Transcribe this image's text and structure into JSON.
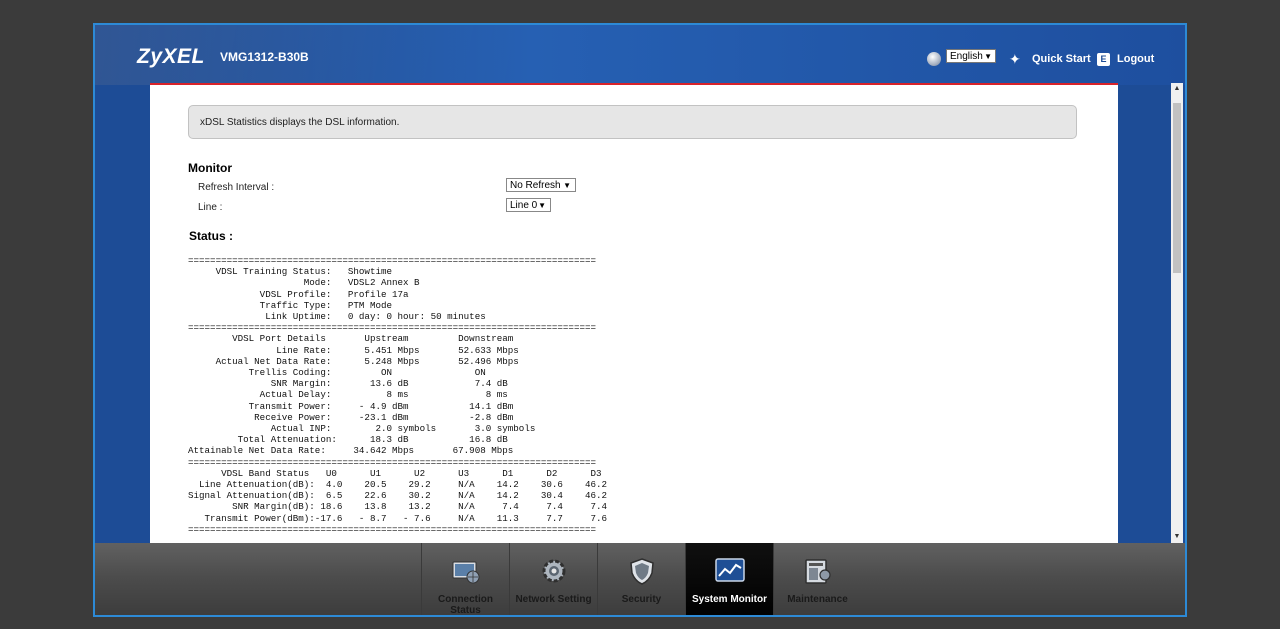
{
  "header": {
    "brand": "ZyXEL",
    "model": "VMG1312-B30B",
    "language": "English",
    "quick_start": "Quick Start",
    "logout": "Logout"
  },
  "info_message": "xDSL Statistics displays the DSL information.",
  "monitor": {
    "title": "Monitor",
    "refresh_label": "Refresh Interval :",
    "refresh_value": "No Refresh",
    "line_label": "Line :",
    "line_value": "Line 0"
  },
  "status": {
    "title": "Status :",
    "text": "==========================================================================\n     VDSL Training Status:   Showtime\n                     Mode:   VDSL2 Annex B\n             VDSL Profile:   Profile 17a\n             Traffic Type:   PTM Mode\n              Link Uptime:   0 day: 0 hour: 50 minutes\n==========================================================================\n        VDSL Port Details       Upstream         Downstream\n                Line Rate:      5.451 Mbps       52.633 Mbps\n     Actual Net Data Rate:      5.248 Mbps       52.496 Mbps\n           Trellis Coding:         ON               ON\n               SNR Margin:       13.6 dB            7.4 dB\n             Actual Delay:          8 ms              8 ms\n           Transmit Power:     - 4.9 dBm           14.1 dBm\n            Receive Power:     -23.1 dBm           -2.8 dBm\n               Actual INP:        2.0 symbols       3.0 symbols\n         Total Attenuation:      18.3 dB           16.8 dB\nAttainable Net Data Rate:     34.642 Mbps       67.908 Mbps\n==========================================================================\n      VDSL Band Status   U0      U1      U2      U3      D1      D2      D3\n  Line Attenuation(dB):  4.0    20.5    29.2     N/A    14.2    30.6    46.2\nSignal Attenuation(dB):  6.5    22.6    30.2     N/A    14.2    30.4    46.2\n        SNR Margin(dB): 18.6    13.8    13.2     N/A     7.4     7.4     7.4\n   Transmit Power(dBm):-17.6   - 8.7   - 7.6     N/A    11.3     7.7     7.6\n=========================================================================="
  },
  "nav": [
    {
      "label": "Connection Status",
      "icon": "connection-status-icon",
      "active": false
    },
    {
      "label": "Network Setting",
      "icon": "gear-icon",
      "active": false
    },
    {
      "label": "Security",
      "icon": "shield-icon",
      "active": false
    },
    {
      "label": "System Monitor",
      "icon": "monitor-chart-icon",
      "active": true
    },
    {
      "label": "Maintenance",
      "icon": "maintenance-icon",
      "active": false
    }
  ],
  "colors": {
    "header_blue": "#1d4c96",
    "frame_border": "#2d8ad6",
    "accent_red": "#d8232a"
  }
}
